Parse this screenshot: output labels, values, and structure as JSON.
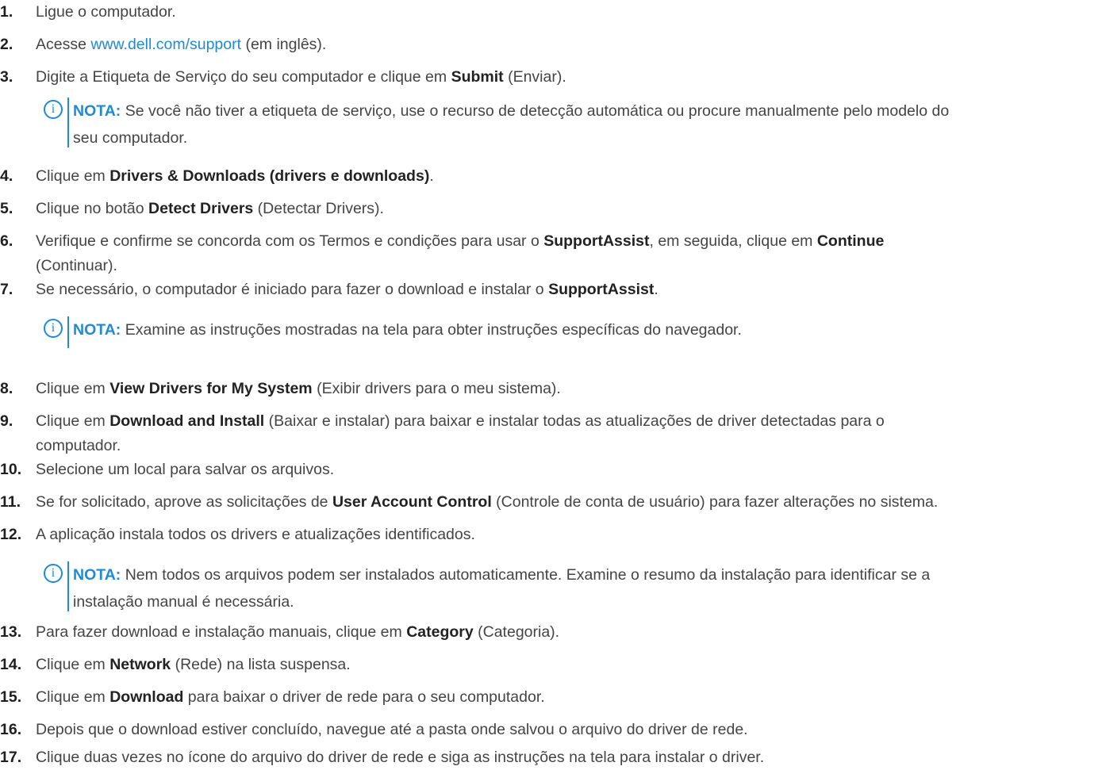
{
  "steps": [
    {
      "num": "1.",
      "parts": [
        {
          "t": "Ligue o computador."
        }
      ]
    },
    {
      "num": "2.",
      "parts": [
        {
          "t": "Acesse "
        },
        {
          "t": "www.dell.com/support",
          "s": "link"
        },
        {
          "t": " (em inglês)."
        }
      ]
    },
    {
      "num": "3.",
      "parts": [
        {
          "t": "Digite a Etiqueta de Serviço do seu computador e clique em "
        },
        {
          "t": "Submit",
          "s": "b"
        },
        {
          "t": " (Enviar)."
        }
      ],
      "note": {
        "label": "NOTA:",
        "lines": [
          " Se você não tiver a etiqueta de serviço, use o recurso de detecção automática ou procure manualmente pelo modelo do",
          "seu computador."
        ]
      }
    },
    {
      "num": "4.",
      "parts": [
        {
          "t": "Clique em "
        },
        {
          "t": "Drivers & Downloads (drivers e downloads)",
          "s": "b"
        },
        {
          "t": "."
        }
      ]
    },
    {
      "num": "5.",
      "parts": [
        {
          "t": "Clique no botão "
        },
        {
          "t": "Detect Drivers",
          "s": "b"
        },
        {
          "t": " (Detectar Drivers)."
        }
      ]
    },
    {
      "num": "6.",
      "parts": [
        {
          "t": "Verifique e confirme se concorda com os Termos e condições para usar o "
        },
        {
          "t": "SupportAssist",
          "s": "b"
        },
        {
          "t": ", em seguida, clique em "
        },
        {
          "t": "Continue",
          "s": "b"
        },
        {
          "t": "\n(Continuar)."
        }
      ]
    },
    {
      "num": "7.",
      "parts": [
        {
          "t": "Se necessário, o computador é iniciado para fazer o download e instalar o "
        },
        {
          "t": "SupportAssist",
          "s": "b"
        },
        {
          "t": "."
        }
      ],
      "note": {
        "label": "NOTA:",
        "lines": [
          " Examine as instruções mostradas na tela para obter instruções específicas do navegador."
        ]
      }
    },
    {
      "num": "8.",
      "parts": [
        {
          "t": "Clique em "
        },
        {
          "t": "View Drivers for My System",
          "s": "b"
        },
        {
          "t": " (Exibir drivers para o meu sistema)."
        }
      ]
    },
    {
      "num": "9.",
      "parts": [
        {
          "t": "Clique em "
        },
        {
          "t": "Download and Install",
          "s": "b"
        },
        {
          "t": " (Baixar e instalar) para baixar e instalar todas as atualizações de driver detectadas para o\ncomputador."
        }
      ]
    },
    {
      "num": "10.",
      "parts": [
        {
          "t": "Selecione um local para salvar os arquivos."
        }
      ]
    },
    {
      "num": "11.",
      "parts": [
        {
          "t": "Se for solicitado, aprove as solicitações de "
        },
        {
          "t": "User Account Control",
          "s": "b"
        },
        {
          "t": " (Controle de conta de usuário) para fazer alterações no sistema."
        }
      ]
    },
    {
      "num": "12.",
      "parts": [
        {
          "t": "A aplicação instala todos os drivers e atualizações identificados."
        }
      ],
      "note": {
        "label": "NOTA:",
        "lines": [
          " Nem todos os arquivos podem ser instalados automaticamente. Examine o resumo da instalação para identificar se a",
          "instalação manual é necessária."
        ]
      }
    },
    {
      "num": "13.",
      "parts": [
        {
          "t": "Para fazer download e instalação manuais, clique em "
        },
        {
          "t": "Category",
          "s": "b"
        },
        {
          "t": " (Categoria)."
        }
      ]
    },
    {
      "num": "14.",
      "parts": [
        {
          "t": "Clique em "
        },
        {
          "t": "Network",
          "s": "b"
        },
        {
          "t": " (Rede) na lista suspensa."
        }
      ]
    },
    {
      "num": "15.",
      "parts": [
        {
          "t": "Clique em "
        },
        {
          "t": "Download",
          "s": "b"
        },
        {
          "t": " para baixar o driver de rede para o seu computador."
        }
      ]
    },
    {
      "num": "16.",
      "parts": [
        {
          "t": "Depois que o download estiver concluído, navegue até a pasta onde salvou o arquivo do driver de rede."
        }
      ]
    },
    {
      "num": "17.",
      "parts": [
        {
          "t": "Clique duas vezes no ícone do arquivo do driver de rede e siga as instruções na tela para instalar o driver."
        }
      ]
    }
  ],
  "colors": {
    "link": "#1e8bd4",
    "text": "#444444",
    "number": "#1f1f1f"
  },
  "icons": {
    "note": "info-icon"
  }
}
